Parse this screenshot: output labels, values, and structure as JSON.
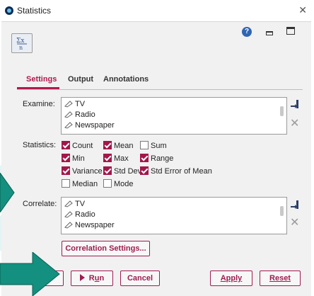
{
  "window": {
    "title": "Statistics"
  },
  "tabs": [
    "Settings",
    "Output",
    "Annotations"
  ],
  "examine": {
    "label": "Examine:",
    "items": [
      "TV",
      "Radio",
      "Newspaper"
    ]
  },
  "statistics": {
    "label": "Statistics:",
    "options": [
      {
        "label": "Count",
        "checked": true
      },
      {
        "label": "Mean",
        "checked": true
      },
      {
        "label": "Sum",
        "checked": false
      },
      {
        "label": "Min",
        "checked": true
      },
      {
        "label": "Max",
        "checked": true
      },
      {
        "label": "Range",
        "checked": true
      },
      {
        "label": "Variance",
        "checked": true
      },
      {
        "label": "Std Dev",
        "checked": true
      },
      {
        "label": "Std Error of Mean",
        "checked": true
      },
      {
        "label": "Median",
        "checked": false
      },
      {
        "label": "Mode",
        "checked": false
      }
    ]
  },
  "correlate": {
    "label": "Correlate:",
    "items": [
      "TV",
      "Radio",
      "Newspaper"
    ],
    "settings_button": "Correlation Settings..."
  },
  "buttons": {
    "run_prefix": "R",
    "run_underlined": "u",
    "run_suffix": "n",
    "cancel": "Cancel",
    "apply_underlined": "A",
    "apply_suffix": "pply",
    "reset_underlined": "R",
    "reset_suffix": "eset"
  },
  "colors": {
    "accent": "#a3164a",
    "arrow": "#13907f",
    "help": "#2f66b3"
  },
  "icons": [
    "app-logo-icon",
    "statistics-node-icon",
    "help-icon",
    "minimize-icon",
    "maximize-icon",
    "close-icon",
    "field-picker-icon",
    "delete-icon",
    "field-ruler-icon",
    "run-icon",
    "pointer-arrow-icon"
  ]
}
